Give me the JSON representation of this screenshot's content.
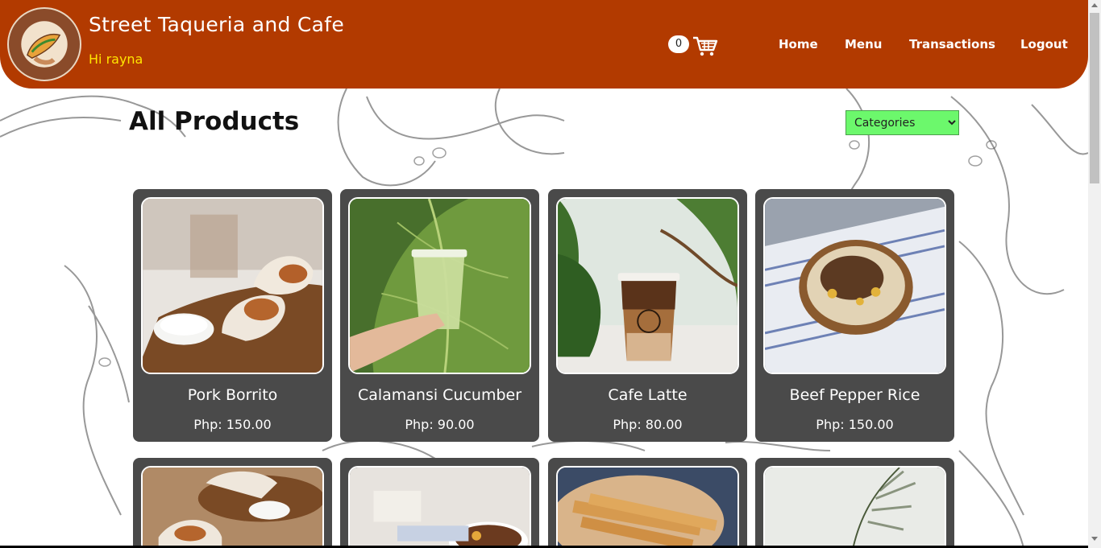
{
  "header": {
    "title": "Street Taqueria and Cafe",
    "greeting": "Hi rayna",
    "logo_text": "STREET TAQUERIA AND CAFE",
    "cart_count": "0",
    "nav": [
      {
        "label": "Home"
      },
      {
        "label": "Menu"
      },
      {
        "label": "Transactions"
      },
      {
        "label": "Logout"
      }
    ]
  },
  "main": {
    "title": "All Products",
    "category_select": {
      "selected": "Categories"
    }
  },
  "products": [
    {
      "name": "Pork Borrito",
      "price": "Php: 150.00",
      "image": "pork-burrito-photo"
    },
    {
      "name": "Calamansi Cucumber",
      "price": "Php: 90.00",
      "image": "calamansi-cucumber-drink-photo"
    },
    {
      "name": "Cafe Latte",
      "price": "Php: 80.00",
      "image": "cafe-latte-photo"
    },
    {
      "name": "Beef Pepper Rice",
      "price": "Php: 150.00",
      "image": "beef-pepper-rice-photo"
    },
    {
      "name": "",
      "price": "",
      "image": "burrito-plate-photo"
    },
    {
      "name": "",
      "price": "",
      "image": "soup-bowl-photo"
    },
    {
      "name": "",
      "price": "",
      "image": "flautas-plate-photo"
    },
    {
      "name": "",
      "price": "",
      "image": "plant-photo"
    }
  ],
  "colors": {
    "header_bg": "#b23a00",
    "greeting": "#ffe600",
    "card_bg": "#4a4a4a",
    "select_bg": "#6cf86c"
  }
}
